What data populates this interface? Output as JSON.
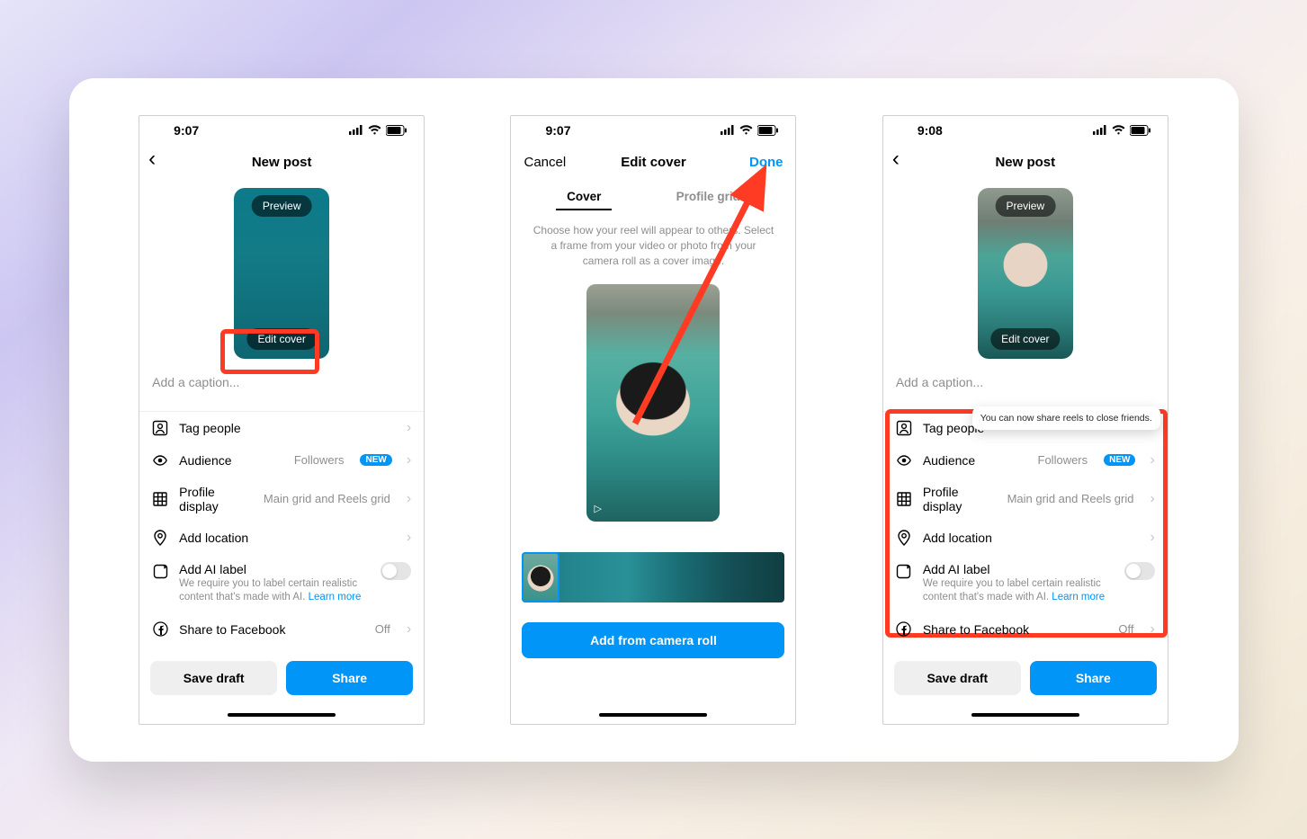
{
  "screen1": {
    "time": "9:07",
    "title": "New post",
    "preview_pill": "Preview",
    "editcover_pill": "Edit cover",
    "caption_placeholder": "Add a caption...",
    "rows": {
      "tag": "Tag people",
      "audience": "Audience",
      "audience_val": "Followers",
      "audience_badge": "NEW",
      "profile": "Profile display",
      "profile_val": "Main grid and Reels grid",
      "location": "Add location",
      "ai_title": "Add AI label",
      "ai_sub": "We require you to label certain realistic content that's made with AI. ",
      "ai_learn": "Learn more",
      "facebook": "Share to Facebook",
      "facebook_val": "Off"
    },
    "save_draft": "Save draft",
    "share": "Share"
  },
  "screen2": {
    "time": "9:07",
    "cancel": "Cancel",
    "title": "Edit cover",
    "done": "Done",
    "tab_cover": "Cover",
    "tab_profile": "Profile grid",
    "helper": "Choose how your reel will appear to others. Select a frame from your video or photo from your camera roll as a cover image.",
    "add_roll": "Add from camera roll"
  },
  "screen3": {
    "time": "9:08",
    "title": "New post",
    "preview_pill": "Preview",
    "editcover_pill": "Edit cover",
    "caption_placeholder": "Add a caption...",
    "tooltip": "You can now share reels to close friends.",
    "rows": {
      "tag": "Tag people",
      "audience": "Audience",
      "audience_val": "Followers",
      "audience_badge": "NEW",
      "profile": "Profile display",
      "profile_val": "Main grid and Reels grid",
      "location": "Add location",
      "ai_title": "Add AI label",
      "ai_sub": "We require you to label certain realistic content that's made with AI. ",
      "ai_learn": "Learn more",
      "facebook": "Share to Facebook",
      "facebook_val": "Off"
    },
    "save_draft": "Save draft",
    "share": "Share"
  }
}
